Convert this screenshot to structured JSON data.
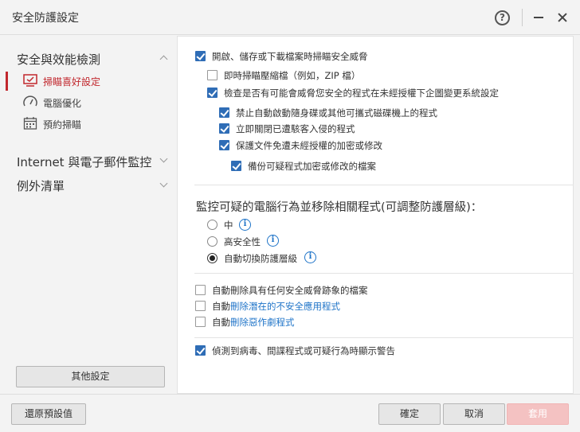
{
  "window": {
    "title": "安全防護設定"
  },
  "sidebar": {
    "sections": [
      {
        "label": "安全與效能檢測"
      },
      {
        "label": "Internet 與電子郵件監控"
      },
      {
        "label": "例外清單"
      }
    ],
    "items": [
      {
        "label": "掃瞄喜好設定",
        "icon": "monitor-icon"
      },
      {
        "label": "電腦優化",
        "icon": "gauge-icon"
      },
      {
        "label": "預約掃瞄",
        "icon": "calendar-icon"
      }
    ],
    "other_settings": "其他設定"
  },
  "main": {
    "options": [
      {
        "label": "開啟、儲存或下載檔案時掃瞄安全威脅",
        "checked": true
      },
      {
        "label": "即時掃瞄壓縮檔（例如，ZIP 檔）",
        "checked": false
      },
      {
        "label": "檢查是否有可能會威脅您安全的程式在未經授權下企圖變更系統設定",
        "checked": true
      },
      {
        "label": "禁止自動啟動隨身碟或其他可攜式磁碟機上的程式",
        "checked": true
      },
      {
        "label": "立即關閉已遭駭客入侵的程式",
        "checked": true
      },
      {
        "label": "保護文件免遭未經授權的加密或修改",
        "checked": true
      },
      {
        "label": "備份可疑程式加密或修改的檔案",
        "checked": true
      }
    ],
    "behavior_heading": "監控可疑的電腦行為並移除相關程式(可調整防護層級)：",
    "levels": [
      {
        "label": "中",
        "selected": false
      },
      {
        "label": "高安全性",
        "selected": false
      },
      {
        "label": "自動切換防護層級",
        "selected": true
      }
    ],
    "info_glyph": "i",
    "remove_options": [
      {
        "prefix": "自動刪除具有任何安全威脅跡象的檔案",
        "link": "",
        "checked": false
      },
      {
        "prefix": "自動",
        "link": "刪除潛在的不安全應用程式",
        "checked": false
      },
      {
        "prefix": "自動",
        "link": "刪除惡作劇程式",
        "checked": false
      }
    ],
    "alert_option": {
      "label": "偵測到病毒、間諜程式或可疑行為時顯示警告",
      "checked": true
    }
  },
  "footer": {
    "restore": "還原預設值",
    "ok": "確定",
    "cancel": "取消",
    "apply": "套用"
  },
  "colors": {
    "accent": "#c1272d",
    "checkbox": "#2f6db6",
    "link": "#1f74c8",
    "apply_disabled": "#f4c2c2"
  }
}
